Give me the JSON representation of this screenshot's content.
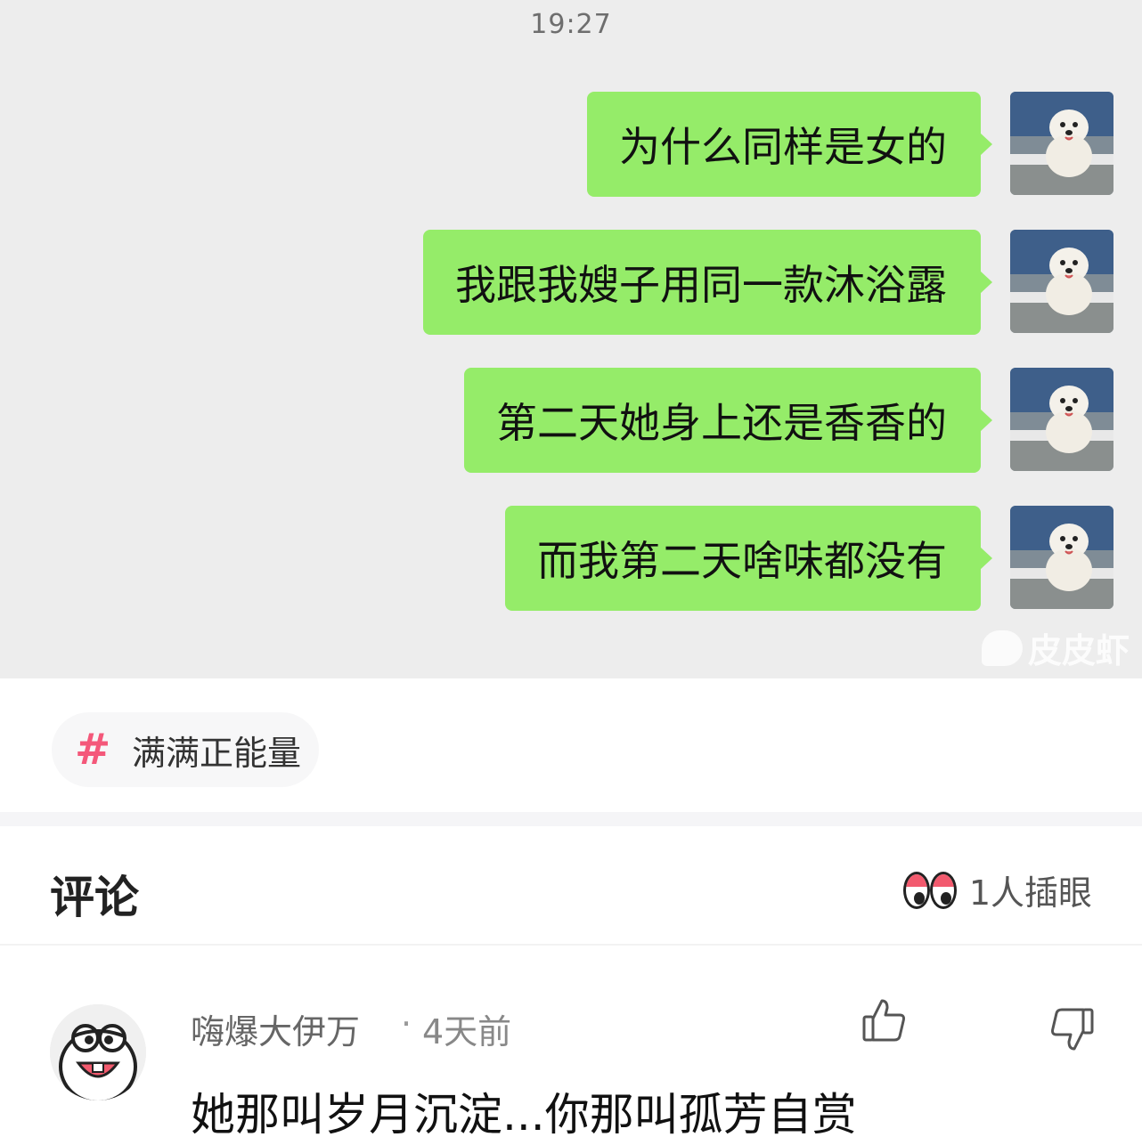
{
  "chat": {
    "time": "19:27",
    "messages": [
      {
        "text": "为什么同样是女的"
      },
      {
        "text": "我跟我嫂子用同一款沐浴露"
      },
      {
        "text": "第二天她身上还是香香的"
      },
      {
        "text": "而我第二天啥味都没有"
      }
    ],
    "bubble_color": "#95ec69",
    "avatar_icon": "dog-avatar-icon",
    "watermark": "皮皮虾"
  },
  "topic": {
    "hash": "#",
    "label": "满满正能量",
    "hash_color": "#f4587a"
  },
  "comments_section": {
    "title": "评论",
    "viewers": "1人插眼",
    "eyes_icon": "eyes-icon"
  },
  "comment": {
    "username": "嗨爆大伊万",
    "dot": "·",
    "time": "4天前",
    "text": "她那叫岁月沉淀...你那叫孤芳自赏",
    "like_icon": "thumbs-up-icon",
    "dislike_icon": "thumbs-down-icon"
  }
}
